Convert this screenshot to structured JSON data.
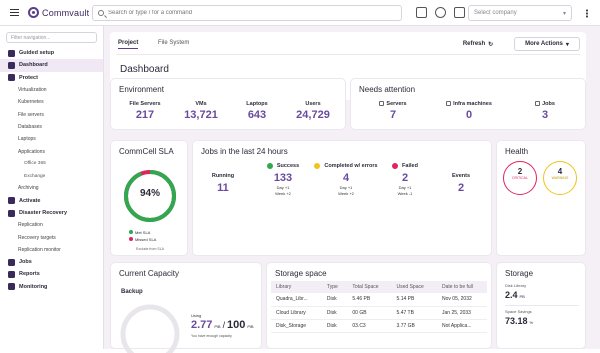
{
  "app": {
    "name": "Commvault"
  },
  "search": {
    "placeholder": "Search or type / for a command"
  },
  "company_select": {
    "placeholder": "Select company"
  },
  "sidebar": {
    "search_placeholder": "Filter navigation...",
    "items": [
      {
        "label": "Guided setup",
        "level": "main"
      },
      {
        "label": "Dashboard",
        "level": "main"
      },
      {
        "label": "Protect",
        "level": "main"
      },
      {
        "label": "Virtualization",
        "level": "sub"
      },
      {
        "label": "Kubernetes",
        "level": "sub"
      },
      {
        "label": "File servers",
        "level": "sub"
      },
      {
        "label": "Databases",
        "level": "sub"
      },
      {
        "label": "Laptops",
        "level": "sub"
      },
      {
        "label": "Applications",
        "level": "sub"
      },
      {
        "label": "Office 365",
        "level": "sub2"
      },
      {
        "label": "Exchange",
        "level": "sub2"
      },
      {
        "label": "Archiving",
        "level": "sub"
      },
      {
        "label": "Activate",
        "level": "main"
      },
      {
        "label": "Disaster Recovery",
        "level": "main"
      },
      {
        "label": "Replication",
        "level": "sub"
      },
      {
        "label": "Recovery targets",
        "level": "sub"
      },
      {
        "label": "Replication monitor",
        "level": "sub"
      },
      {
        "label": "Jobs",
        "level": "main"
      },
      {
        "label": "Reports",
        "level": "main"
      },
      {
        "label": "Monitoring",
        "level": "main"
      }
    ]
  },
  "header": {
    "tabs": [
      "Project",
      "File System"
    ],
    "refresh_label": "Refresh",
    "more_actions_label": "More Actions",
    "page_title": "Dashboard"
  },
  "environment": {
    "title": "Environment",
    "stats": [
      {
        "label": "File Servers",
        "value": "217"
      },
      {
        "label": "VMs",
        "value": "13,721"
      },
      {
        "label": "Laptops",
        "value": "643"
      },
      {
        "label": "Users",
        "value": "24,729"
      }
    ]
  },
  "needs_attention": {
    "title": "Needs attention",
    "stats": [
      {
        "label": "Servers",
        "value": "7"
      },
      {
        "label": "Infra machines",
        "value": "0"
      },
      {
        "label": "Jobs",
        "value": "3"
      }
    ]
  },
  "sla": {
    "title": "CommCell SLA",
    "percent": "94%",
    "fraction": 0.94,
    "legend": [
      "Met SLA",
      "Missed SLA"
    ],
    "footer": "Exclude from SLA",
    "colors": {
      "met": "#2fa84f",
      "missed": "#e0245e"
    }
  },
  "jobs24": {
    "title": "Jobs in the last 24 hours",
    "running": {
      "label": "Running",
      "value": "11"
    },
    "columns": [
      {
        "label": "Success",
        "value": "133",
        "color": "#2fa84f",
        "sub1": "Day +1",
        "sub2": "Week +2"
      },
      {
        "label": "Completed w/ errors",
        "value": "4",
        "color": "#f0c419",
        "sub1": "Day +1",
        "sub2": "Week +2"
      },
      {
        "label": "Failed",
        "value": "2",
        "color": "#e0245e",
        "sub1": "Day +1",
        "sub2": "Week -1"
      }
    ],
    "events": {
      "label": "Events",
      "value": "2"
    }
  },
  "health": {
    "title": "Health",
    "items": [
      {
        "value": "2",
        "label": "CRITICAL",
        "color": "#e0245e"
      },
      {
        "value": "4",
        "label": "WARNING",
        "color": "#f0c419"
      }
    ]
  },
  "capacity": {
    "title": "Current Capacity",
    "subtitle": "Backup",
    "used_label": "Using",
    "used_value": "2.77",
    "used_unit": "PiB",
    "separator": "/",
    "total_value": "100",
    "total_unit": "PiB",
    "note": "You have enough capacity"
  },
  "storage_space": {
    "title": "Storage space",
    "columns": [
      "Library",
      "Type",
      "Total Space",
      "Used Space",
      "Date to be full"
    ],
    "rows": [
      [
        "Quadra_Libr...",
        "Disk",
        "5.46 PB",
        "5.14 PB",
        "Nov 05, 2032"
      ],
      [
        "Cloud Library",
        "Disk",
        "00 GB",
        "5.47 TB",
        "Jan 25, 2033"
      ],
      [
        "Disk_Storage",
        "Disk",
        "03.C3",
        "3.77 GB",
        "Not Applica..."
      ]
    ]
  },
  "storage": {
    "title": "Storage",
    "disk_label": "Disk Library",
    "disk_value": "2.4",
    "disk_unit": "PB",
    "savings_label": "Space Savings",
    "savings_value": "73.18",
    "savings_unit": "%"
  }
}
